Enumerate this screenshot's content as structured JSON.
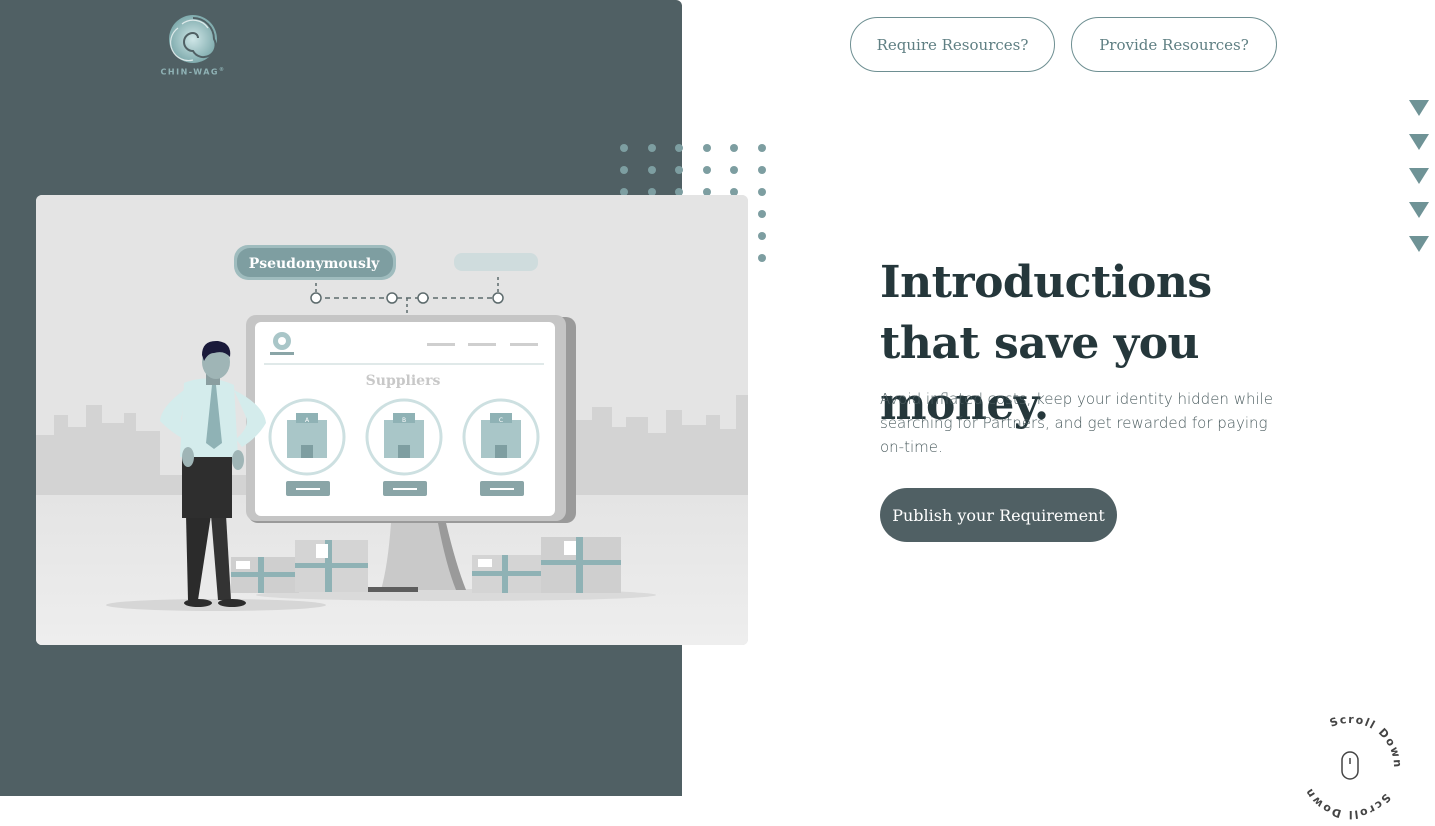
{
  "brand": {
    "name": "CHIN-WAG",
    "trademark": "®"
  },
  "nav": {
    "require_label": "Require Resources?",
    "provide_label": "Provide Resources?"
  },
  "hero": {
    "title": "Introductions that save you money.",
    "subtitle": "Avoid inflated costs, keep your identity hidden while searching for Partners, and get rewarded for paying on-time.",
    "cta_label": "Publish your Requirement"
  },
  "illustration": {
    "tag_label": "Pseudonymously",
    "screen_title": "Suppliers",
    "supplier_letters": [
      "A",
      "B",
      "C"
    ]
  },
  "scroll": {
    "label": "Scroll Down"
  },
  "icons": {
    "nav_arrows": "triangle-down-icon",
    "scroll": "mouse-icon",
    "logo": "chin-wag-logo"
  },
  "colors": {
    "panel": "#506064",
    "accent": "#6f9396",
    "title": "#25373b",
    "cta": "#506064"
  }
}
